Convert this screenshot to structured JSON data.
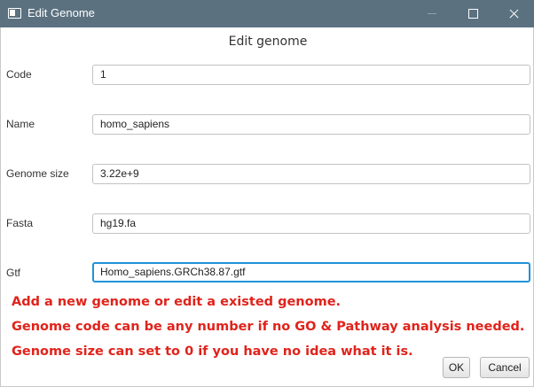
{
  "window": {
    "title": "Edit Genome",
    "icon": "window-app-icon"
  },
  "dialog": {
    "heading": "Edit genome",
    "fields": [
      {
        "label": "Code",
        "value": "1"
      },
      {
        "label": "Name",
        "value": "homo_sapiens"
      },
      {
        "label": "Genome size",
        "value": "3.22e+9"
      },
      {
        "label": "Fasta",
        "value": "hg19.fa"
      },
      {
        "label": "Gtf",
        "value": "Homo_sapiens.GRCh38.87.gtf",
        "focused": true
      }
    ],
    "notes": [
      "Add a new genome or edit a existed genome.",
      "Genome code can be any number if no GO & Pathway analysis needed.",
      "Genome size can set to 0 if you have no idea what it is."
    ],
    "ok_label": "OK",
    "cancel_label": "Cancel"
  },
  "colors": {
    "titlebar": "#5b7180",
    "note_text": "#e0231b",
    "focus_border": "#1f93d9"
  }
}
